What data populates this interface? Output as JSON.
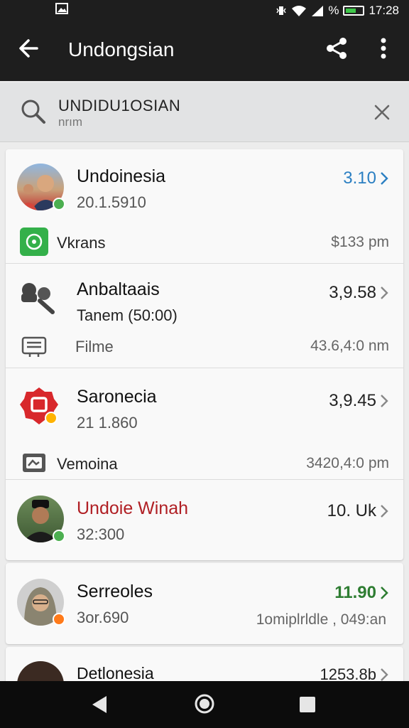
{
  "status_bar": {
    "battery_pct": "%",
    "time": "17:28"
  },
  "app_bar": {
    "title": "Undongsian"
  },
  "search": {
    "query": "UNDIDU1OSIAN",
    "hint": "nrım"
  },
  "colors": {
    "accent_blue": "#2b7fc2",
    "accent_red": "#b01f24",
    "accent_green": "#2e7d32",
    "badge_green": "#4caf50",
    "badge_orange": "#ff7a1a"
  },
  "items": [
    {
      "name": "Undoinesia",
      "sub": "20.1.5910",
      "value": "3.10",
      "sub_label": "Vkrans",
      "sub_time": "$133 pm"
    },
    {
      "name": "Anbaltaais",
      "sub": "Tanem (50:00)",
      "value": "3,9.58",
      "sub_label": "Filme",
      "sub_time": "43.6,4:0 nm"
    },
    {
      "name": "Saronecia",
      "sub": "21 1.860",
      "value": "3,9.45",
      "sub_label": "Vemoina",
      "sub_time": "3420,4:0 pm"
    },
    {
      "name": "Undoie Winah",
      "sub": "32:300",
      "value": "10. Uk"
    },
    {
      "name": "Serreoles",
      "sub": "3or.690",
      "value": "11.90",
      "sub_time": "1omiplrldle , 049:an"
    },
    {
      "name": "Detlonesia",
      "value": "1253.8b"
    }
  ]
}
